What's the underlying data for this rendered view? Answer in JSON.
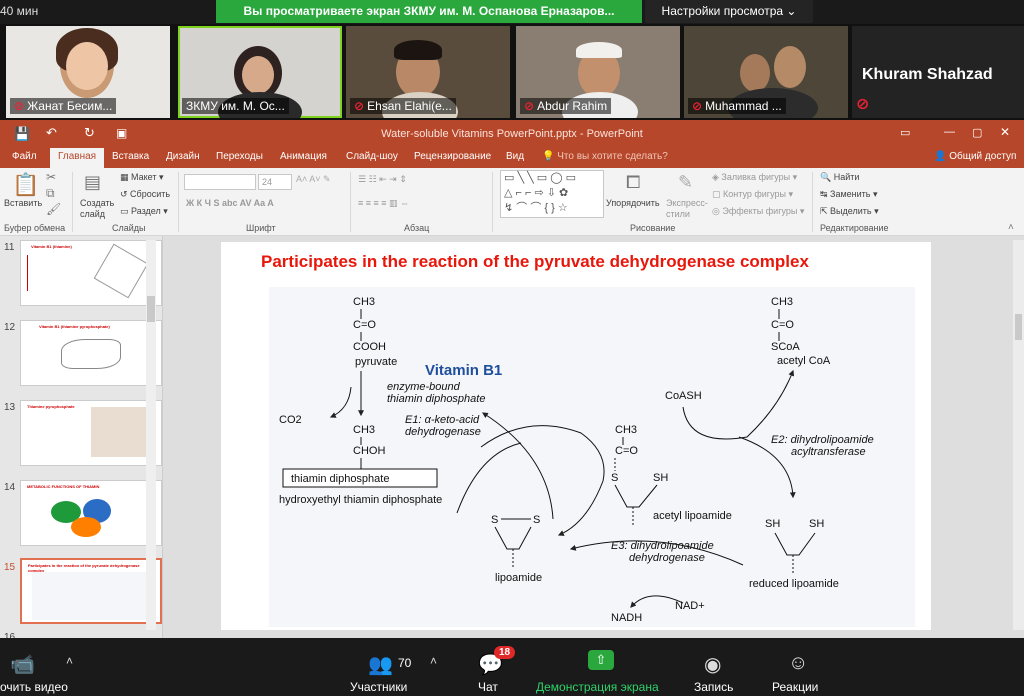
{
  "zoom_top": {
    "timer": "40 мин",
    "share_banner": "Вы просматриваете экран ЗКМУ им. М. Оспанова Ерназаров...",
    "view_settings": "Настройки просмотра"
  },
  "participants": [
    {
      "name": "Жанат Бесим..."
    },
    {
      "name": "ЗКМУ им. М. Ос..."
    },
    {
      "name": "Ehsan Elahi(e..."
    },
    {
      "name": "Abdur Rahim"
    },
    {
      "name": "Muhammad ..."
    }
  ],
  "big_name": "Khuram Shahzad",
  "ppt": {
    "window_title": "Water-soluble Vitamins PowerPoint.pptx - PowerPoint",
    "tabs": [
      "Файл",
      "Главная",
      "Вставка",
      "Дизайн",
      "Переходы",
      "Анимация",
      "Слайд-шоу",
      "Рецензирование",
      "Вид"
    ],
    "tell_me": "Что вы хотите сделать?",
    "share": "Общий доступ",
    "ribbon": {
      "paste": "Вставить",
      "clipboard": "Буфер обмена",
      "create_slide": "Создать слайд",
      "layout": "Макет",
      "reset": "Сбросить",
      "section": "Раздел",
      "slides": "Слайды",
      "font_size": "24",
      "font": "Шрифт",
      "paragraph": "Абзац",
      "arrange": "Упорядочить",
      "express_styles": "Экспресс-стили",
      "drawing": "Рисование",
      "fill": "Заливка фигуры",
      "outline": "Контур фигуры",
      "effects": "Эффекты фигуры",
      "find": "Найти",
      "replace": "Заменить",
      "select": "Выделить",
      "editing": "Редактирование"
    },
    "thumbs": [
      {
        "num": "11",
        "title": "Vitamin B1 (thiamine)"
      },
      {
        "num": "12",
        "title": "Vitamin B1 (thiamine pyrophosphate)"
      },
      {
        "num": "13",
        "title": "Thiamine pyrophosphate"
      },
      {
        "num": "14",
        "title": "METABOLIC FUNCTIONS OF THIAMIN"
      },
      {
        "num": "15",
        "title": "Participates in the reaction of the pyruvate dehydrogenase complex"
      },
      {
        "num": "16",
        "title": ""
      }
    ],
    "slide": {
      "title": "Participates in the reaction of the pyruvate dehydrogenase complex",
      "diagram": {
        "ch3": "CH3",
        "c_o": "C=O",
        "cooh": "COOH",
        "pyruvate": "pyruvate",
        "vitamin_b1": "Vitamin B1",
        "enzyme_bound": "enzyme-bound",
        "tdp": "thiamin diphosphate",
        "e1": "E1: α-keto-acid",
        "e1b": "dehydrogenase",
        "co2": "CO2",
        "choh": "CHOH",
        "thiamin_box": "thiamin diphosphate",
        "hydroxyethyl": "hydroxyethyl thiamin diphosphate",
        "scoa": "SCoA",
        "acetyl_coa": "acetyl CoA",
        "coash": "CoASH",
        "e2": "E2: dihydrolipoamide",
        "e2b": "acyltransferase",
        "s": "S",
        "sh": "SH",
        "acetyl_lipoamide": "acetyl lipoamide",
        "lipoamide": "lipoamide",
        "e3": "E3: dihydrolipoamide",
        "e3b": "dehydrogenase",
        "reduced_lipoamide": "reduced lipoamide",
        "nadh": "NADH",
        "nad": "NAD+"
      }
    }
  },
  "zoom_bottom": {
    "stop_video": "очить видео",
    "participants_label": "Участники",
    "participants_count": "70",
    "chat_label": "Чат",
    "chat_badge": "18",
    "share_screen": "Демонстрация экрана",
    "record": "Запись",
    "reactions": "Реакции"
  }
}
